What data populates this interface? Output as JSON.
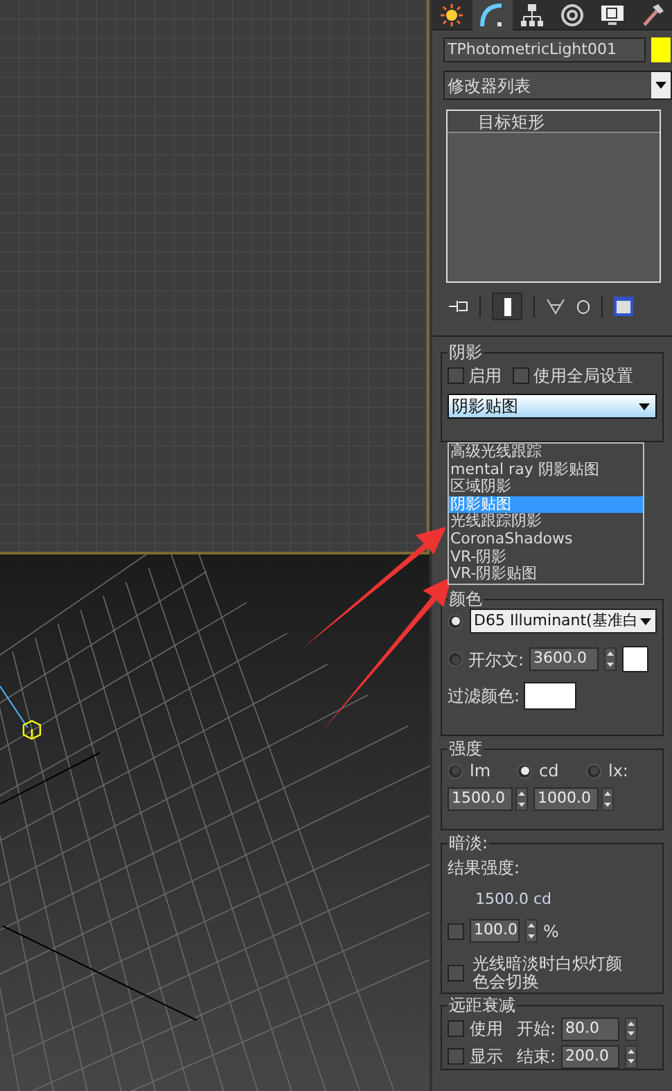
{
  "panel_tabs": [
    {
      "kind": "create",
      "selected": false
    },
    {
      "kind": "modify",
      "selected": true
    },
    {
      "kind": "hierarchy",
      "selected": false
    },
    {
      "kind": "motion",
      "selected": false
    },
    {
      "kind": "display",
      "selected": false
    },
    {
      "kind": "utilities",
      "selected": false
    }
  ],
  "object_name": {
    "value": "TPhotometricLight001"
  },
  "modifier_list": {
    "value": "修改器列表"
  },
  "stack": [
    {
      "label": "目标矩形"
    }
  ],
  "shadows": {
    "title": "阴影",
    "options": [
      {
        "label": "启用",
        "checked": false
      },
      {
        "label": "使用全局设置",
        "checked": false
      }
    ],
    "type": "阴影贴图",
    "dropdown_items": [
      {
        "label": "高级光线跟踪",
        "selected": false
      },
      {
        "label": "mental ray 阴影贴图",
        "selected": false
      },
      {
        "label": "区域阴影",
        "selected": false
      },
      {
        "label": "阴影贴图",
        "selected": true
      },
      {
        "label": "光线跟踪阴影",
        "selected": false
      },
      {
        "label": "CoronaShadows",
        "selected": false
      },
      {
        "label": "VR-阴影",
        "selected": false
      },
      {
        "label": "VR-阴影贴图",
        "selected": false
      }
    ]
  },
  "color": {
    "title": "颜色",
    "preset": {
      "selected": true,
      "value": "D65 Illuminant(基准白"
    },
    "kelvin": {
      "label": "开尔文:",
      "selected": false,
      "value": "3600.0"
    },
    "filter_label": "过滤颜色:"
  },
  "intensity": {
    "title": "强度",
    "units": [
      {
        "label": "lm",
        "selected": false
      },
      {
        "label": "cd",
        "selected": true
      },
      {
        "label": "lx:",
        "selected": false
      }
    ],
    "values": [
      "1500.0",
      "1000.0"
    ]
  },
  "dimming": {
    "title": "暗淡:",
    "result_label": "结果强度:",
    "result_value": "1500.0 cd",
    "percent": {
      "checked": false,
      "value": "100.0",
      "unit": "%"
    },
    "incandescent": {
      "checked": false,
      "label": "光线暗淡时白炽灯颜色会切换"
    }
  },
  "far_attenuation": {
    "title": "远距衰减",
    "use": {
      "label": "使用",
      "checked": false
    },
    "show": {
      "label": "显示",
      "checked": false
    },
    "start": {
      "label": "开始:",
      "value": "80.0"
    },
    "end": {
      "label": "结束:",
      "value": "200.0"
    }
  }
}
